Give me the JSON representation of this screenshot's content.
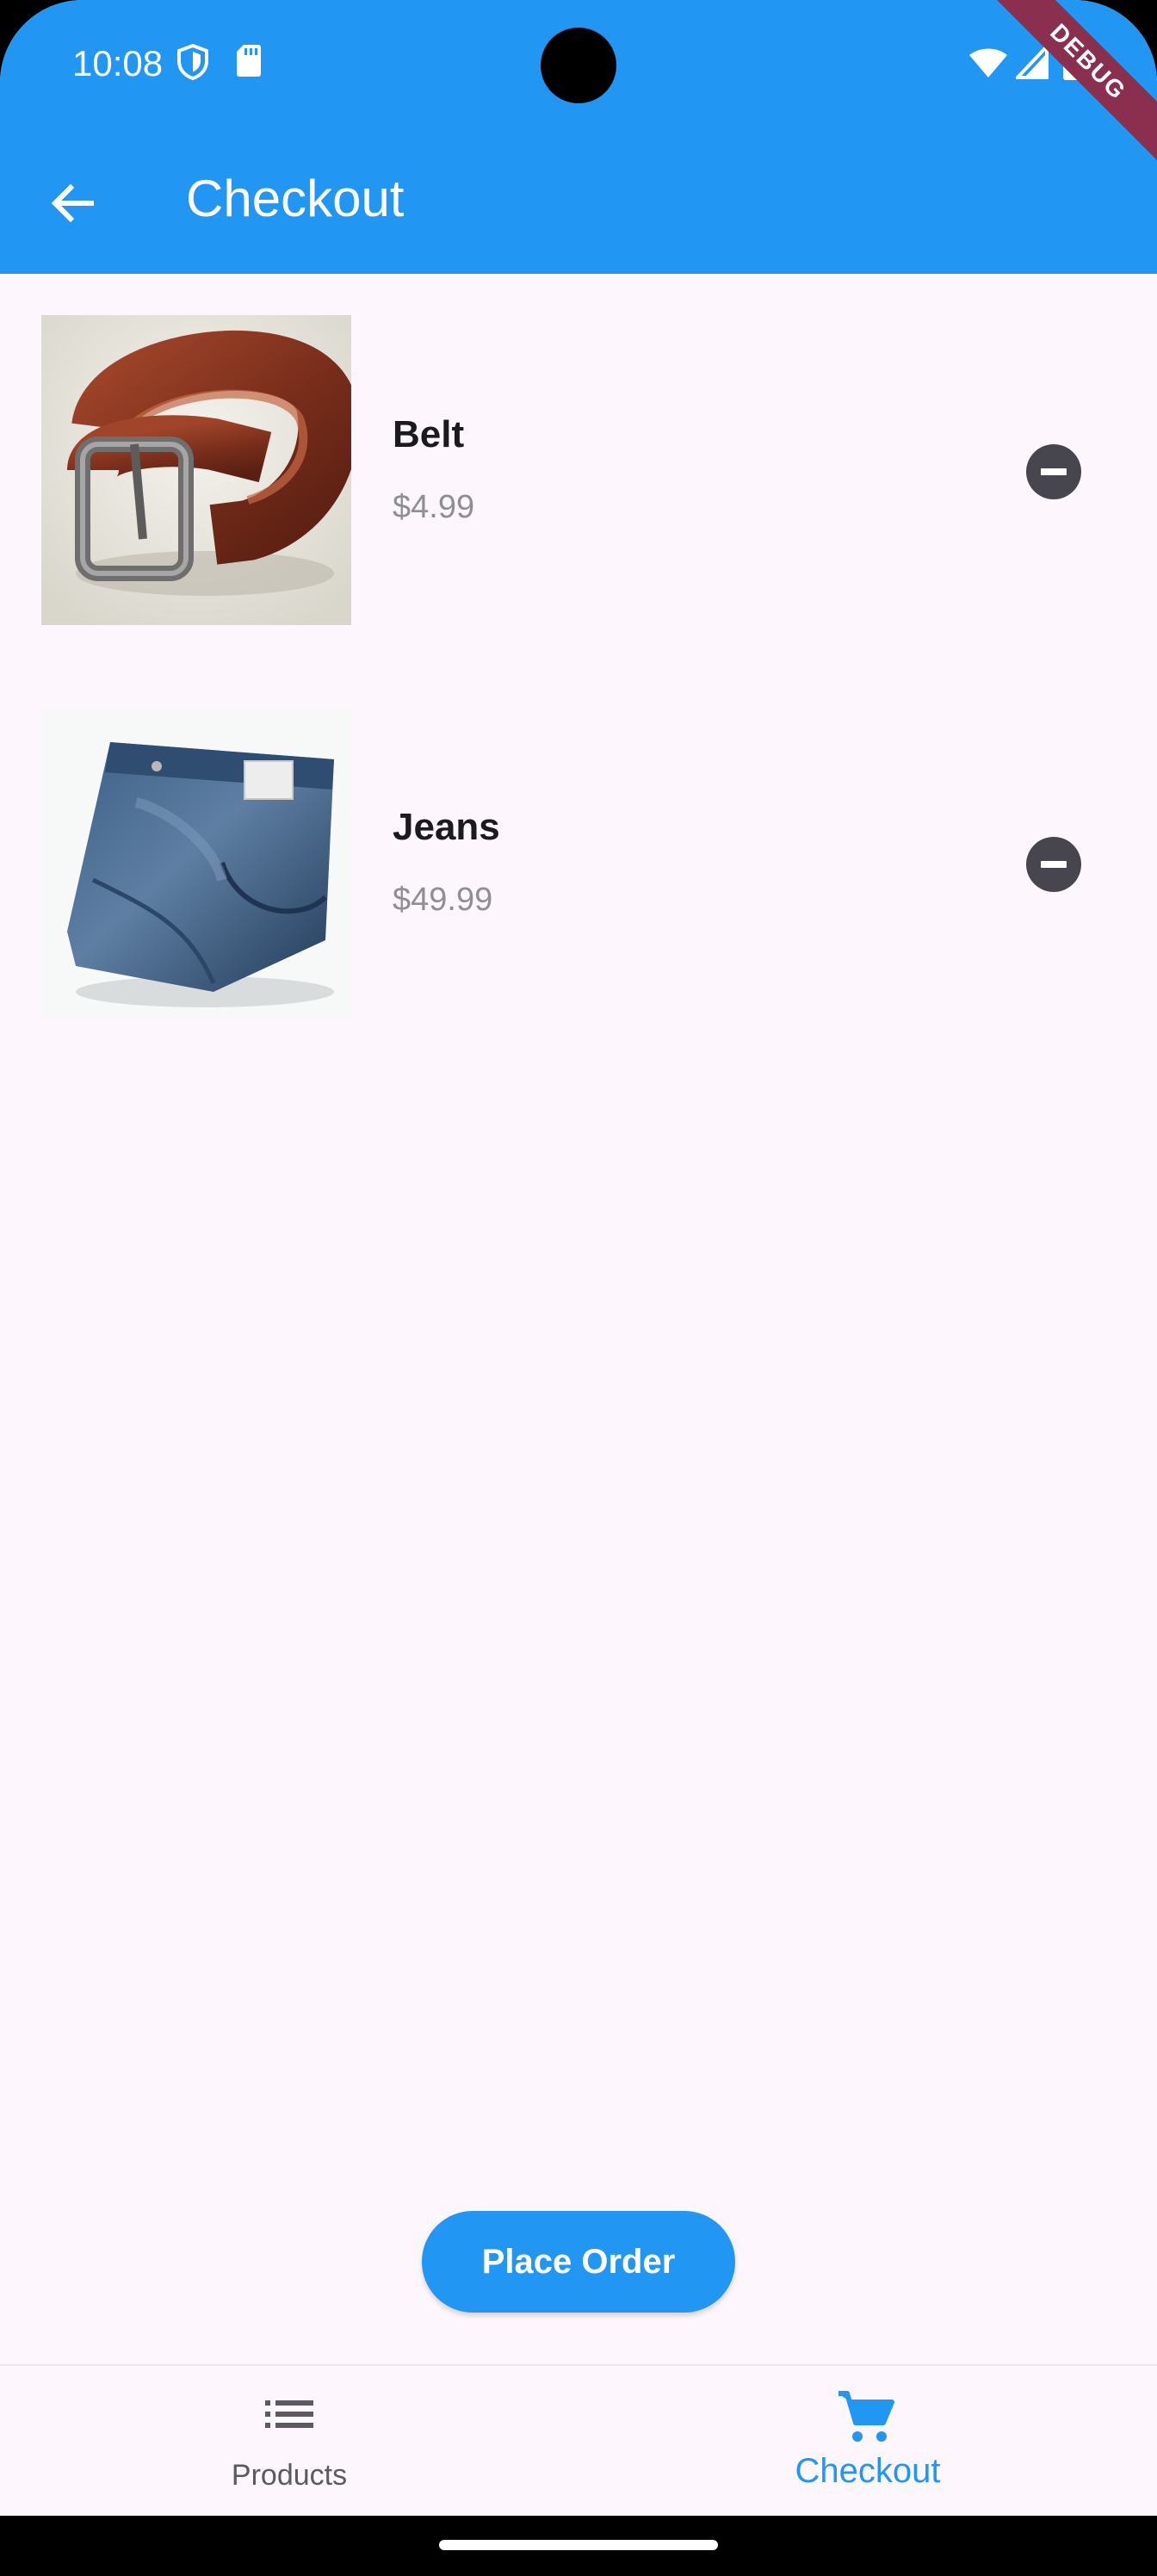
{
  "status_bar": {
    "time": "10:08"
  },
  "debug_label": "DEBUG",
  "app_bar": {
    "title": "Checkout"
  },
  "cart_items": [
    {
      "name": "Belt",
      "price": "$4.99"
    },
    {
      "name": "Jeans",
      "price": "$49.99"
    }
  ],
  "place_order_label": "Place Order",
  "bottom_nav": {
    "items": [
      {
        "label": "Products",
        "icon": "list-icon",
        "active": false
      },
      {
        "label": "Checkout",
        "icon": "cart-icon",
        "active": true
      }
    ]
  },
  "colors": {
    "primary": "#2196F3",
    "background": "#FDF7FD",
    "remove_button": "#47464F"
  }
}
